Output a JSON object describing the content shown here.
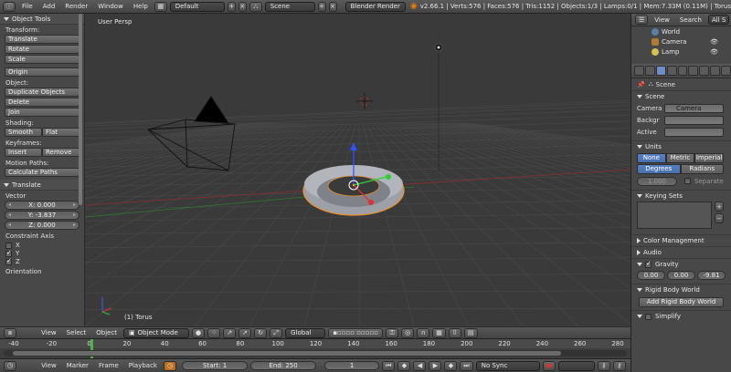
{
  "header": {
    "menus": [
      "File",
      "Add",
      "Render",
      "Window",
      "Help"
    ],
    "screen_layout": "Default",
    "scene": "Scene",
    "render_engine": "Blender Render",
    "stats": "v2.66.1 | Verts:576 | Faces:576 | Tris:1152 | Objects:1/3 | Lamps:0/1 | Mem:7.33M (0.11M) | Torus"
  },
  "toolshelf": {
    "title": "Object Tools",
    "transform_label": "Transform:",
    "transform_buttons": [
      "Translate",
      "Rotate",
      "Scale"
    ],
    "origin": "Origin",
    "object_label": "Object:",
    "object_buttons": [
      "Duplicate Objects",
      "Delete",
      "Join"
    ],
    "shading_label": "Shading:",
    "smooth": "Smooth",
    "flat": "Flat",
    "keyframes_label": "Keyframes:",
    "insert": "Insert",
    "remove": "Remove",
    "motion_label": "Motion Paths:",
    "calc_paths": "Calculate Paths",
    "op_title": "Translate",
    "vector_label": "Vector",
    "vector": [
      "X: 0.000",
      "Y: -3.837",
      "Z: 0.000"
    ],
    "constraint_label": "Constraint Axis",
    "axes": [
      {
        "label": "X",
        "checked": false
      },
      {
        "label": "Y",
        "checked": true
      },
      {
        "label": "Z",
        "checked": true
      }
    ],
    "orientation_label": "Orientation"
  },
  "viewport": {
    "view_name": "User Persp",
    "active_object": "(1) Torus"
  },
  "viewport_header": {
    "menus": [
      "View",
      "Select",
      "Object"
    ],
    "mode": "Object Mode",
    "orientation": "Global"
  },
  "timeline": {
    "ticks": [
      "-40",
      "-20",
      "0",
      "20",
      "40",
      "60",
      "80",
      "100",
      "120",
      "140",
      "160",
      "180",
      "200",
      "220",
      "240",
      "260",
      "280"
    ],
    "current_frame": 1
  },
  "bottombar": {
    "menus": [
      "View",
      "Marker",
      "Frame",
      "Playback"
    ],
    "start": "Start: 1",
    "end": "End: 250",
    "frame": "1",
    "sync": "No Sync"
  },
  "outliner": {
    "view": "View",
    "search": "Search",
    "all": "All S",
    "items": [
      "World",
      "Camera",
      "Lamp"
    ]
  },
  "properties": {
    "breadcrumb": "Scene",
    "scene_panel": "Scene",
    "camera_label": "Camera",
    "camera_value": "Camera",
    "background_label": "Backgr",
    "active_label": "Active",
    "units_panel": "Units",
    "unit_systems": [
      "None",
      "Metric",
      "Imperial"
    ],
    "rotation_units": [
      "Degrees",
      "Radians"
    ],
    "scale_value": "1.000",
    "separate_label": "Separate",
    "keying_sets": "Keying Sets",
    "color_management": "Color Management",
    "audio": "Audio",
    "gravity": "Gravity",
    "gravity_values": [
      "0.00",
      "0.00",
      "-9.81"
    ],
    "rigid_body_world": "Rigid Body World",
    "add_rigid_body": "Add Rigid Body World",
    "simplify": "Simplify"
  }
}
